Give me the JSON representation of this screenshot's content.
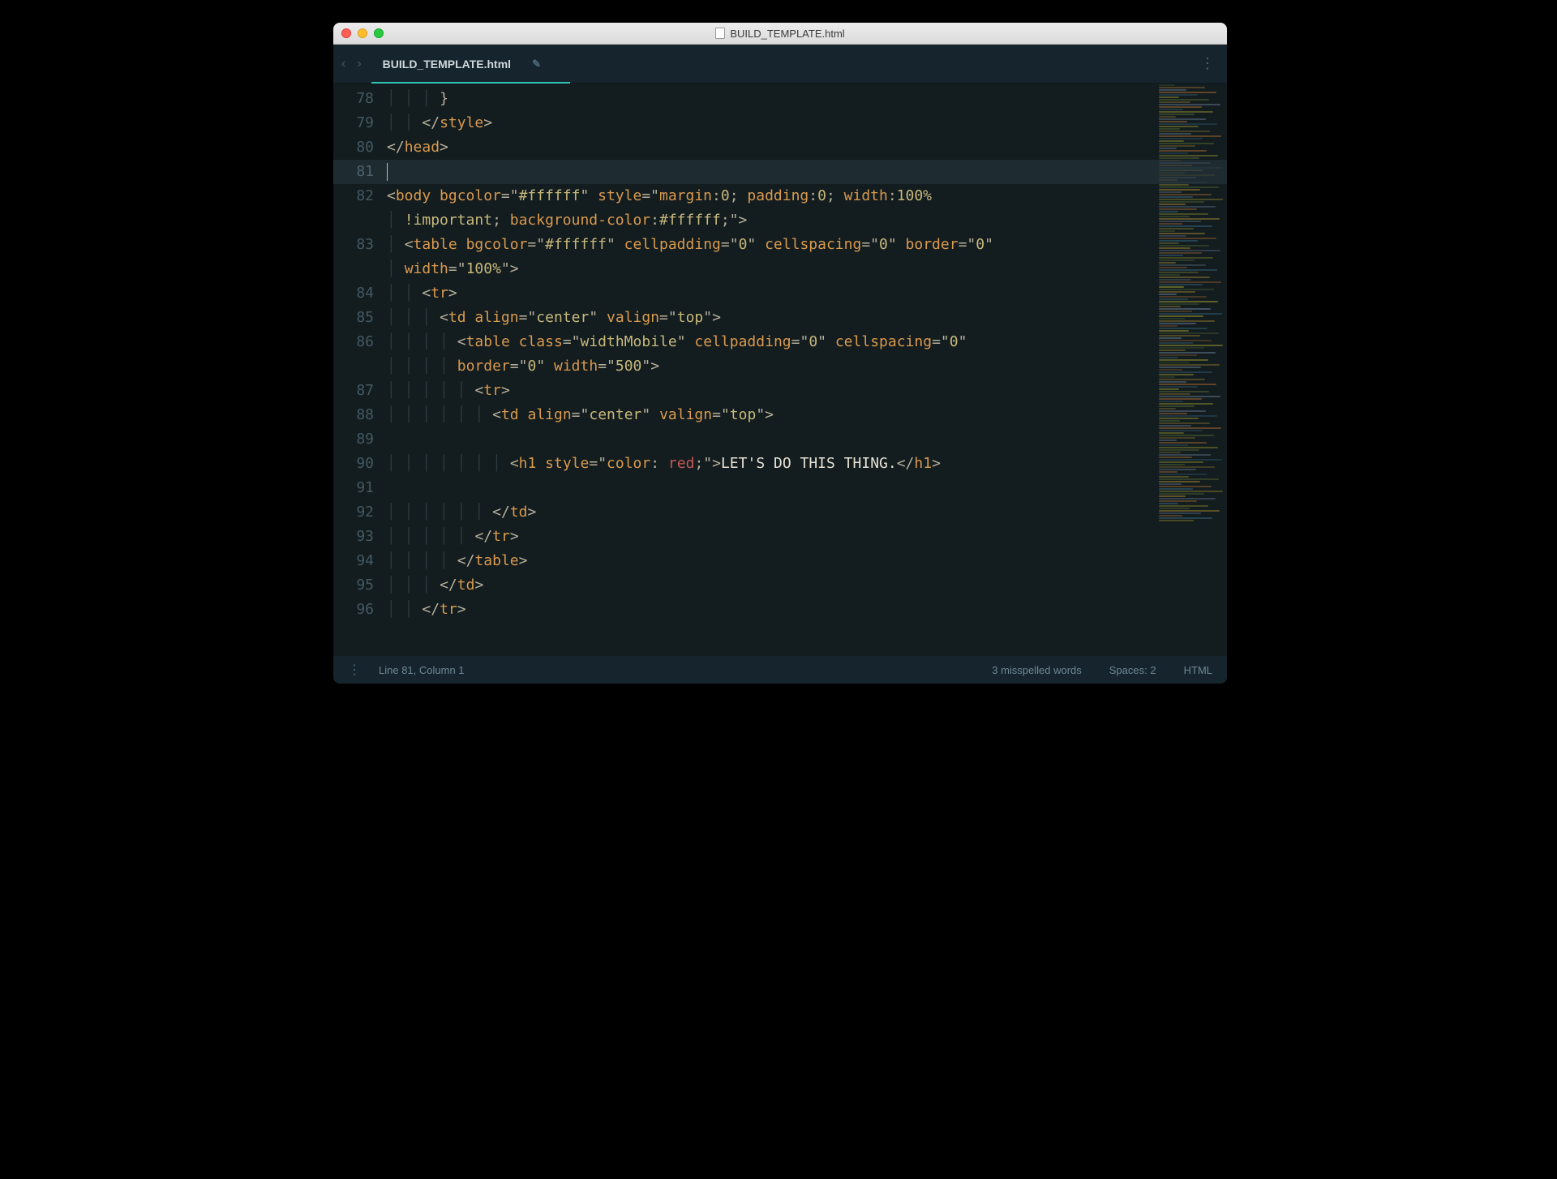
{
  "window": {
    "title": "BUILD_TEMPLATE.html"
  },
  "tab": {
    "filename": "BUILD_TEMPLATE.html"
  },
  "gutter": {
    "start": 78,
    "end": 96,
    "active_line": 81
  },
  "code": {
    "lines": [
      {
        "n": 78,
        "indent": 3,
        "tokens": [
          [
            "punct",
            "}"
          ]
        ]
      },
      {
        "n": 79,
        "indent": 2,
        "tokens": [
          [
            "punct",
            "</"
          ],
          [
            "tag",
            "style"
          ],
          [
            "punct",
            ">"
          ]
        ]
      },
      {
        "n": 80,
        "indent": 0,
        "tokens": [
          [
            "punct",
            "</"
          ],
          [
            "tag",
            "head"
          ],
          [
            "punct",
            ">"
          ]
        ]
      },
      {
        "n": 81,
        "indent": 0,
        "tokens": [
          [
            "cursor",
            ""
          ]
        ]
      },
      {
        "n": 82,
        "indent": 0,
        "tokens": [
          [
            "punct",
            "<"
          ],
          [
            "tag",
            "body "
          ],
          [
            "attr",
            "bgcolor"
          ],
          [
            "eq",
            "="
          ],
          [
            "punct",
            "\""
          ],
          [
            "str",
            "#ffffff"
          ],
          [
            "punct",
            "\" "
          ],
          [
            "attr",
            "style"
          ],
          [
            "eq",
            "="
          ],
          [
            "punct",
            "\""
          ],
          [
            "css-prop",
            "margin"
          ],
          [
            "punct",
            ":"
          ],
          [
            "css-val",
            "0"
          ],
          [
            "punct",
            "; "
          ],
          [
            "css-prop",
            "padding"
          ],
          [
            "punct",
            ":"
          ],
          [
            "css-val",
            "0"
          ],
          [
            "punct",
            "; "
          ],
          [
            "css-prop",
            "width"
          ],
          [
            "punct",
            ":"
          ],
          [
            "css-val",
            "100%"
          ]
        ]
      },
      {
        "n": "82b",
        "indent": 1,
        "tokens": [
          [
            "css-val",
            "!important"
          ],
          [
            "punct",
            "; "
          ],
          [
            "css-prop",
            "background-color"
          ],
          [
            "punct",
            ":"
          ],
          [
            "str",
            "#ffffff"
          ],
          [
            "punct",
            ";\""
          ],
          [
            "punct",
            ">"
          ]
        ]
      },
      {
        "n": 83,
        "indent": 1,
        "tokens": [
          [
            "punct",
            "<"
          ],
          [
            "tag",
            "table "
          ],
          [
            "attr",
            "bgcolor"
          ],
          [
            "eq",
            "="
          ],
          [
            "punct",
            "\""
          ],
          [
            "str",
            "#ffffff"
          ],
          [
            "punct",
            "\" "
          ],
          [
            "attr",
            "cellpadding"
          ],
          [
            "eq",
            "="
          ],
          [
            "punct",
            "\""
          ],
          [
            "str",
            "0"
          ],
          [
            "punct",
            "\" "
          ],
          [
            "attr",
            "cellspacing"
          ],
          [
            "eq",
            "="
          ],
          [
            "punct",
            "\""
          ],
          [
            "str",
            "0"
          ],
          [
            "punct",
            "\" "
          ],
          [
            "attr",
            "border"
          ],
          [
            "eq",
            "="
          ],
          [
            "punct",
            "\""
          ],
          [
            "str",
            "0"
          ],
          [
            "punct",
            "\""
          ]
        ]
      },
      {
        "n": "83b",
        "indent": 1,
        "tokens": [
          [
            "attr",
            "width"
          ],
          [
            "eq",
            "="
          ],
          [
            "punct",
            "\""
          ],
          [
            "str",
            "100%"
          ],
          [
            "punct",
            "\""
          ],
          [
            "punct",
            ">"
          ]
        ]
      },
      {
        "n": 84,
        "indent": 2,
        "tokens": [
          [
            "punct",
            "<"
          ],
          [
            "tag",
            "tr"
          ],
          [
            "punct",
            ">"
          ]
        ]
      },
      {
        "n": 85,
        "indent": 3,
        "tokens": [
          [
            "punct",
            "<"
          ],
          [
            "tag",
            "td "
          ],
          [
            "attr",
            "align"
          ],
          [
            "eq",
            "="
          ],
          [
            "punct",
            "\""
          ],
          [
            "str",
            "center"
          ],
          [
            "punct",
            "\" "
          ],
          [
            "attr",
            "valign"
          ],
          [
            "eq",
            "="
          ],
          [
            "punct",
            "\""
          ],
          [
            "str",
            "top"
          ],
          [
            "punct",
            "\""
          ],
          [
            "punct",
            ">"
          ]
        ]
      },
      {
        "n": 86,
        "indent": 4,
        "tokens": [
          [
            "punct",
            "<"
          ],
          [
            "tag",
            "table "
          ],
          [
            "attr",
            "class"
          ],
          [
            "eq",
            "="
          ],
          [
            "punct",
            "\""
          ],
          [
            "str",
            "widthMobile"
          ],
          [
            "punct",
            "\" "
          ],
          [
            "attr",
            "cellpadding"
          ],
          [
            "eq",
            "="
          ],
          [
            "punct",
            "\""
          ],
          [
            "str",
            "0"
          ],
          [
            "punct",
            "\" "
          ],
          [
            "attr",
            "cellspacing"
          ],
          [
            "eq",
            "="
          ],
          [
            "punct",
            "\""
          ],
          [
            "str",
            "0"
          ],
          [
            "punct",
            "\""
          ]
        ]
      },
      {
        "n": "86b",
        "indent": 4,
        "tokens": [
          [
            "attr",
            "border"
          ],
          [
            "eq",
            "="
          ],
          [
            "punct",
            "\""
          ],
          [
            "str",
            "0"
          ],
          [
            "punct",
            "\" "
          ],
          [
            "attr",
            "width"
          ],
          [
            "eq",
            "="
          ],
          [
            "punct",
            "\""
          ],
          [
            "str",
            "500"
          ],
          [
            "punct",
            "\""
          ],
          [
            "punct",
            ">"
          ]
        ]
      },
      {
        "n": 87,
        "indent": 5,
        "tokens": [
          [
            "punct",
            "<"
          ],
          [
            "tag",
            "tr"
          ],
          [
            "punct",
            ">"
          ]
        ]
      },
      {
        "n": 88,
        "indent": 6,
        "tokens": [
          [
            "punct",
            "<"
          ],
          [
            "tag",
            "td "
          ],
          [
            "attr",
            "align"
          ],
          [
            "eq",
            "="
          ],
          [
            "punct",
            "\""
          ],
          [
            "str",
            "center"
          ],
          [
            "punct",
            "\" "
          ],
          [
            "attr",
            "valign"
          ],
          [
            "eq",
            "="
          ],
          [
            "punct",
            "\""
          ],
          [
            "str",
            "top"
          ],
          [
            "punct",
            "\""
          ],
          [
            "punct",
            ">"
          ]
        ]
      },
      {
        "n": 89,
        "indent": 0,
        "tokens": []
      },
      {
        "n": 90,
        "indent": 7,
        "tokens": [
          [
            "punct",
            "<"
          ],
          [
            "tag",
            "h1 "
          ],
          [
            "attr",
            "style"
          ],
          [
            "eq",
            "="
          ],
          [
            "punct",
            "\""
          ],
          [
            "css-prop",
            "color"
          ],
          [
            "punct",
            ": "
          ],
          [
            "kw-red",
            "red"
          ],
          [
            "punct",
            ";\""
          ],
          [
            "punct",
            ">"
          ],
          [
            "txt",
            "LET'S DO THIS THING."
          ],
          [
            "punct",
            "</"
          ],
          [
            "tag",
            "h1"
          ],
          [
            "punct",
            ">"
          ]
        ]
      },
      {
        "n": 91,
        "indent": 0,
        "tokens": []
      },
      {
        "n": 92,
        "indent": 6,
        "tokens": [
          [
            "punct",
            "</"
          ],
          [
            "tag",
            "td"
          ],
          [
            "punct",
            ">"
          ]
        ]
      },
      {
        "n": 93,
        "indent": 5,
        "tokens": [
          [
            "punct",
            "</"
          ],
          [
            "tag",
            "tr"
          ],
          [
            "punct",
            ">"
          ]
        ]
      },
      {
        "n": 94,
        "indent": 4,
        "tokens": [
          [
            "punct",
            "</"
          ],
          [
            "tag",
            "table"
          ],
          [
            "punct",
            ">"
          ]
        ]
      },
      {
        "n": 95,
        "indent": 3,
        "tokens": [
          [
            "punct",
            "</"
          ],
          [
            "tag",
            "td"
          ],
          [
            "punct",
            ">"
          ]
        ]
      },
      {
        "n": 96,
        "indent": 2,
        "tokens": [
          [
            "punct",
            "</"
          ],
          [
            "tag",
            "tr"
          ],
          [
            "punct",
            ">"
          ]
        ]
      }
    ]
  },
  "statusbar": {
    "position": "Line 81, Column 1",
    "spell": "3 misspelled words",
    "indent": "Spaces: 2",
    "lang": "HTML"
  }
}
